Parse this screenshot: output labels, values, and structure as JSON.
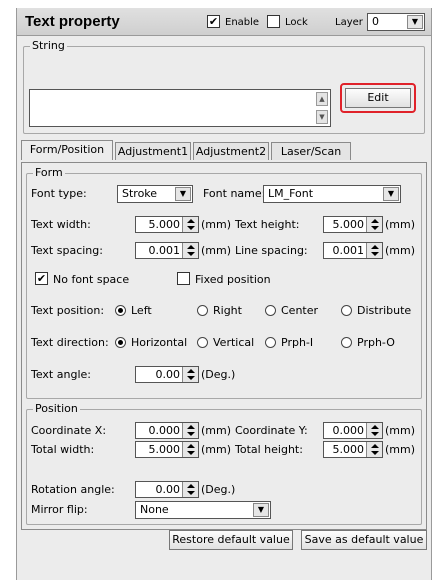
{
  "header": {
    "title": "Text property",
    "enable_label": "Enable",
    "enable_checked": true,
    "lock_label": "Lock",
    "lock_checked": false,
    "layer_label": "Layer",
    "layer_value": "0"
  },
  "string_group": {
    "title": "String",
    "value": "",
    "edit_label": "Edit"
  },
  "tabs": [
    "Form/Position",
    "Adjustment1",
    "Adjustment2",
    "Laser/Scan"
  ],
  "form": {
    "title": "Form",
    "font_type_label": "Font type:",
    "font_type_value": "Stroke",
    "font_name_label": "Font name:",
    "font_name_value": "LM_Font",
    "text_width_label": "Text width:",
    "text_width_value": "5.000",
    "text_height_label": "Text height:",
    "text_height_value": "5.000",
    "text_spacing_label": "Text spacing:",
    "text_spacing_value": "0.001",
    "line_spacing_label": "Line spacing:",
    "line_spacing_value": "0.001",
    "unit_mm": "(mm)",
    "unit_deg": "(Deg.)",
    "no_font_space_label": "No font space",
    "no_font_space_checked": true,
    "fixed_position_label": "Fixed position",
    "fixed_position_checked": false,
    "text_position_label": "Text position:",
    "text_position_options": [
      "Left",
      "Right",
      "Center",
      "Distribute"
    ],
    "text_position_selected": "Left",
    "text_direction_label": "Text direction:",
    "text_direction_options": [
      "Horizontal",
      "Vertical",
      "Prph-I",
      "Prph-O"
    ],
    "text_direction_selected": "Horizontal",
    "text_angle_label": "Text angle:",
    "text_angle_value": "0.00"
  },
  "position": {
    "title": "Position",
    "coord_x_label": "Coordinate X:",
    "coord_x_value": "0.000",
    "coord_y_label": "Coordinate Y:",
    "coord_y_value": "0.000",
    "total_width_label": "Total width:",
    "total_width_value": "5.000",
    "total_height_label": "Total height:",
    "total_height_value": "5.000",
    "rotation_label": "Rotation angle:",
    "rotation_value": "0.00",
    "mirror_label": "Mirror flip:",
    "mirror_value": "None"
  },
  "footer": {
    "restore_label": "Restore default value",
    "save_label": "Save as default value"
  },
  "colors": {
    "highlight": "#e0222a"
  }
}
